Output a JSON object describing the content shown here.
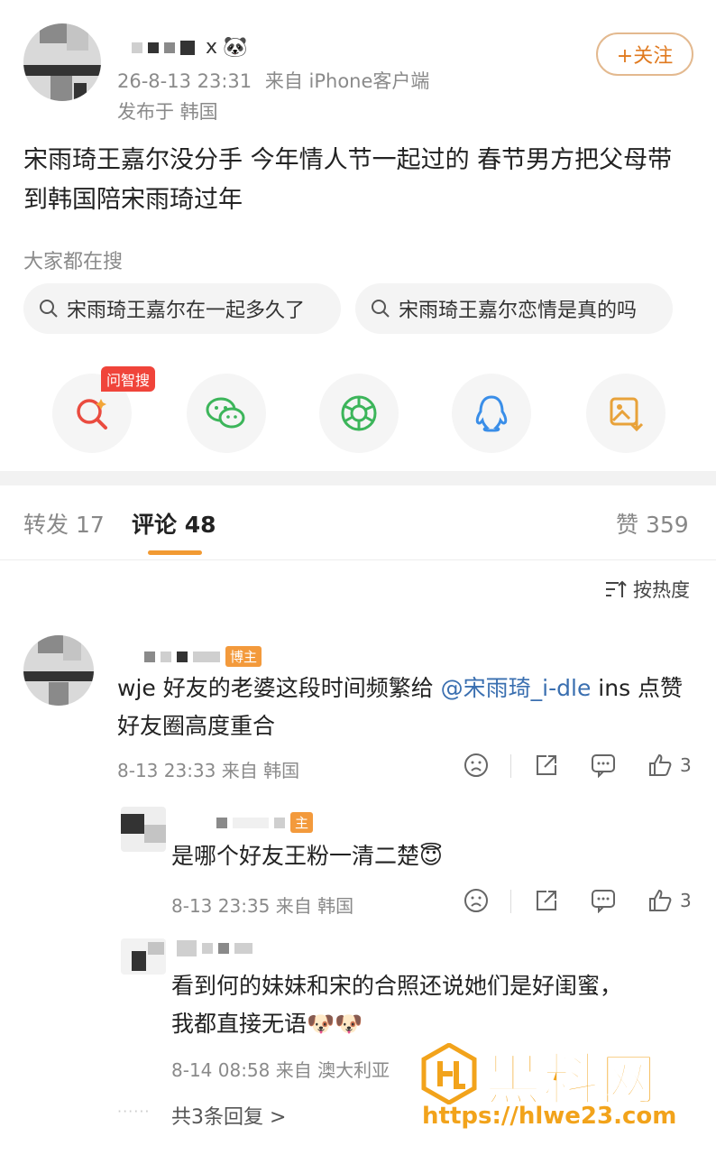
{
  "post": {
    "author_suffix": "x",
    "author_emoji": "🐼",
    "timestamp": "26-8-13 23:31",
    "source": "来自 iPhone客户端",
    "location": "发布于 韩国",
    "follow_label": "+关注",
    "text": "宋雨琦王嘉尔没分手 今年情人节一起过的 春节男方把父母带到韩国陪宋雨琦过年"
  },
  "search": {
    "label": "大家都在搜",
    "chips": [
      "宋雨琦王嘉尔在一起多久了",
      "宋雨琦王嘉尔恋情是真的吗"
    ]
  },
  "share": {
    "badge": "问智搜",
    "icons": [
      "ai-search-icon",
      "wechat-icon",
      "moments-icon",
      "qq-icon",
      "save-image-icon"
    ]
  },
  "tabs": {
    "repost": "转发 17",
    "comments": "评论 48",
    "likes": "赞 359"
  },
  "sort_label": "按热度",
  "comments": [
    {
      "tag": "博主",
      "text_pre": "wje 好友的老婆这段时间频繁给 ",
      "mention": "@宋雨琦_i-dle",
      "text_post": " ins 点赞  好友圈高度重合",
      "meta": "8-13 23:33 来自 韩国",
      "likes": "3"
    }
  ],
  "replies": [
    {
      "tag": "主",
      "text": "是哪个好友王粉一清二楚",
      "emoji": "😇",
      "meta": "8-13 23:35 来自 韩国",
      "likes": "3"
    },
    {
      "line1": "看到何的妹妹和宋的合照还说她们是好闺蜜，",
      "line2": "我都直接无语",
      "emoji": "🐶🐶",
      "meta": "8-14 08:58 来自 澳大利亚"
    }
  ],
  "more_replies": "共3条回复 >",
  "watermark": {
    "title": "黑料网",
    "url": "https://hlwe23.com"
  }
}
